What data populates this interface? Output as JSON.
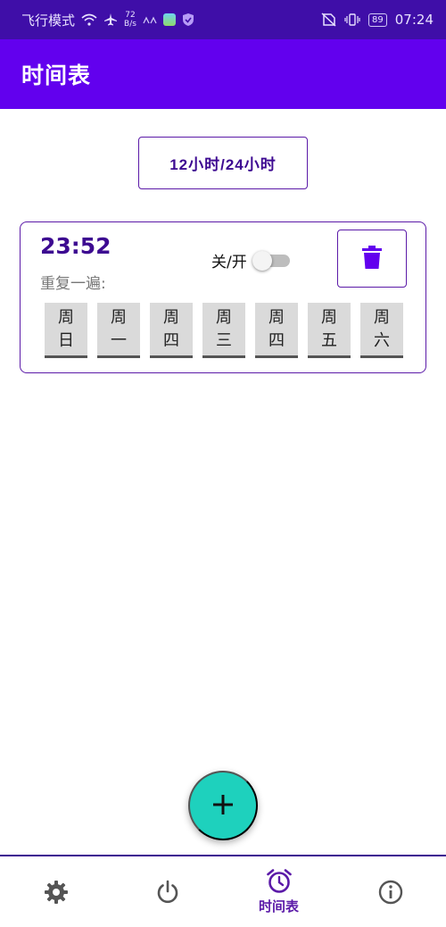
{
  "status_bar": {
    "mode": "飞行模式",
    "speed_value": "72",
    "speed_unit": "B/s",
    "battery": "89",
    "time": "07:24"
  },
  "app_bar": {
    "title": "时间表"
  },
  "format_toggle": {
    "label": "12小时/24小时"
  },
  "alarm": {
    "time": "23:52",
    "repeat_label": "重复一遍:",
    "switch_label": "关/开",
    "enabled": false,
    "days": [
      {
        "top": "周",
        "bottom": "日"
      },
      {
        "top": "周",
        "bottom": "一"
      },
      {
        "top": "周",
        "bottom": "四"
      },
      {
        "top": "周",
        "bottom": "三"
      },
      {
        "top": "周",
        "bottom": "四"
      },
      {
        "top": "周",
        "bottom": "五"
      },
      {
        "top": "周",
        "bottom": "六"
      }
    ]
  },
  "fab": {
    "icon": "plus-icon"
  },
  "bottom_nav": {
    "items": [
      {
        "icon": "gear-icon",
        "label": ""
      },
      {
        "icon": "power-icon",
        "label": ""
      },
      {
        "icon": "alarm-clock-icon",
        "label": "时间表"
      },
      {
        "icon": "info-icon",
        "label": ""
      }
    ]
  },
  "colors": {
    "status_bar": "#3f0ea8",
    "app_bar": "#6200ee",
    "accent": "#3d0a91",
    "fab": "#1ed1bd"
  }
}
